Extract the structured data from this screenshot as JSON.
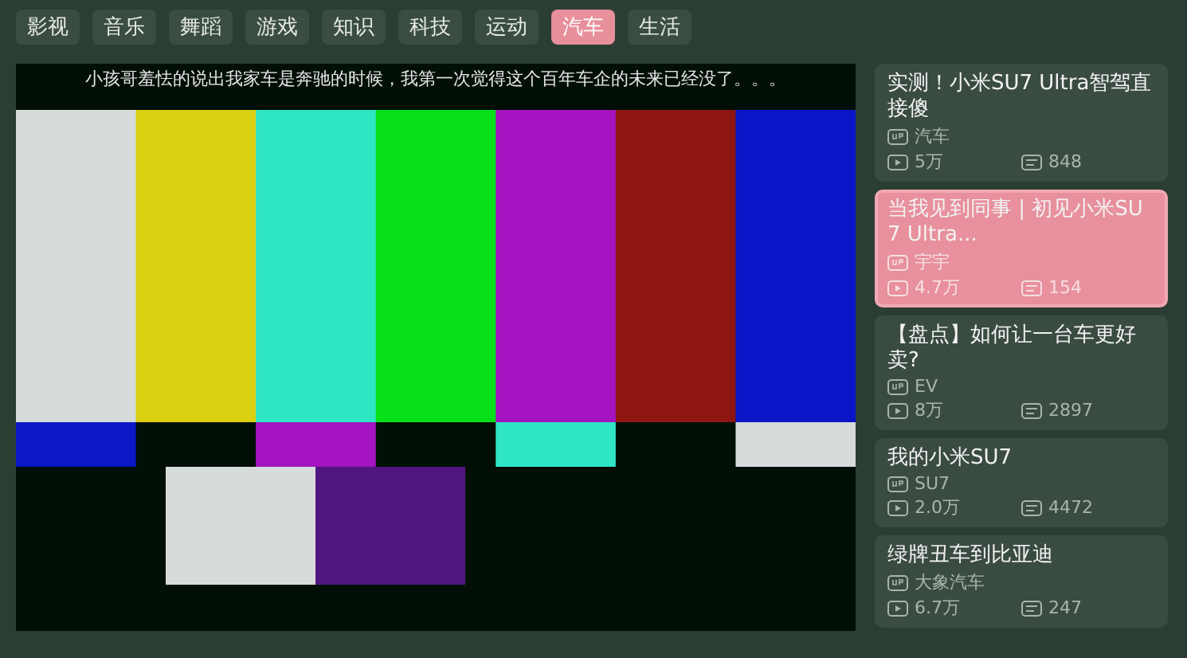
{
  "tabs": [
    {
      "label": "影视",
      "selected": false
    },
    {
      "label": "音乐",
      "selected": false
    },
    {
      "label": "舞蹈",
      "selected": false
    },
    {
      "label": "游戏",
      "selected": false
    },
    {
      "label": "知识",
      "selected": false
    },
    {
      "label": "科技",
      "selected": false
    },
    {
      "label": "运动",
      "selected": false
    },
    {
      "label": "汽车",
      "selected": true
    },
    {
      "label": "生活",
      "selected": false
    }
  ],
  "player": {
    "subtitle": "小孩哥羞怯的说出我家车是奔驰的时候，我第一次觉得这个百年车企的未来已经没了。。。"
  },
  "videos": [
    {
      "title": "实测！小米SU7 Ultra智驾直接傻",
      "uploader": "汽车",
      "views": "5万",
      "danmaku": "848",
      "selected": false
    },
    {
      "title": "当我见到同事 | 初见小米SU7 Ultra...",
      "uploader": "宇宇",
      "views": "4.7万",
      "danmaku": "154",
      "selected": true
    },
    {
      "title": "【盘点】如何让一台车更好卖?",
      "uploader": "EV",
      "views": "8万",
      "danmaku": "2897",
      "selected": false
    },
    {
      "title": "我的小米SU7",
      "uploader": "SU7",
      "views": "2.0万",
      "danmaku": "4472",
      "selected": false
    },
    {
      "title": "绿牌丑车到比亚迪",
      "uploader": "大象汽车",
      "views": "6.7万",
      "danmaku": "247",
      "selected": false
    }
  ]
}
